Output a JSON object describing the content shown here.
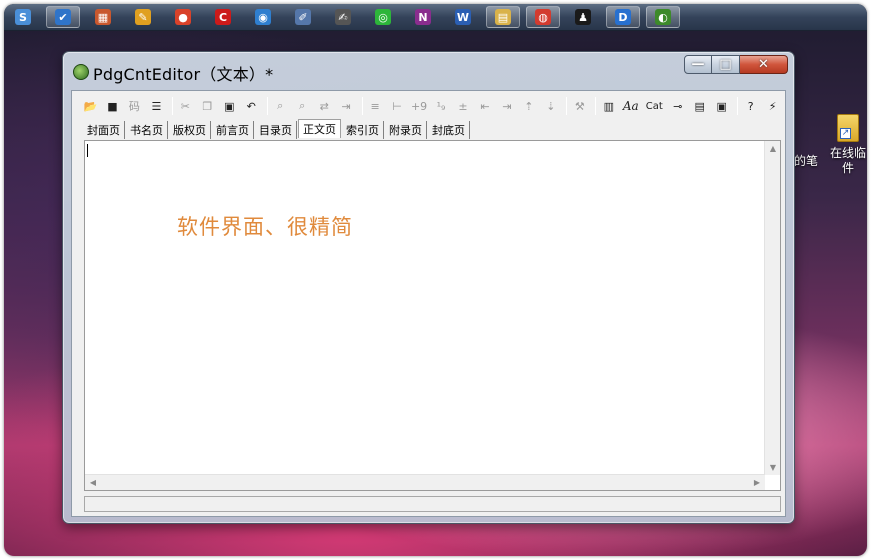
{
  "window": {
    "title": "PdgCntEditor（文本）*",
    "controls": {
      "minimize": "—",
      "maximize": "□",
      "close": "✕"
    }
  },
  "taskbar": {
    "apps": [
      {
        "icon": "shield-icon",
        "glyph": "S",
        "color": "#4a8fd8",
        "active": false
      },
      {
        "icon": "qq-browser-icon",
        "glyph": "✔",
        "color": "#2f74c9",
        "active": true
      },
      {
        "icon": "tools-icon",
        "glyph": "▦",
        "color": "#c9582e",
        "active": false
      },
      {
        "icon": "paint-icon",
        "glyph": "✎",
        "color": "#e0a020",
        "active": false
      },
      {
        "icon": "fox-icon",
        "glyph": "●",
        "color": "#d9422a",
        "active": false
      },
      {
        "icon": "flash-icon",
        "glyph": "C",
        "color": "#cc1a1a",
        "active": false
      },
      {
        "icon": "globe-icon",
        "glyph": "◉",
        "color": "#2f7fcf",
        "active": false
      },
      {
        "icon": "notes-icon",
        "glyph": "✐",
        "color": "#5577aa",
        "active": false
      },
      {
        "icon": "edit-icon",
        "glyph": "✍",
        "color": "#555555",
        "active": false
      },
      {
        "icon": "wechat-icon",
        "glyph": "◎",
        "color": "#2db53a",
        "active": false
      },
      {
        "icon": "onenote-icon",
        "glyph": "N",
        "color": "#8a2d8e",
        "active": false
      },
      {
        "icon": "word-icon",
        "glyph": "W",
        "color": "#2b5fb3",
        "active": false
      },
      {
        "icon": "folder-icon",
        "glyph": "▤",
        "color": "#d9b24a",
        "active": true
      },
      {
        "icon": "chrome-icon",
        "glyph": "◍",
        "color": "#d33b2f",
        "active": true
      },
      {
        "icon": "qq-icon",
        "glyph": "♟",
        "color": "#1a1a1a",
        "active": false
      },
      {
        "icon": "player-icon",
        "glyph": "D",
        "color": "#2770d0",
        "active": true
      },
      {
        "icon": "pdgcnteditor-icon",
        "glyph": "◐",
        "color": "#3d8a2a",
        "active": true
      }
    ]
  },
  "toolbar": {
    "cat_label": "Cat",
    "aa_label": "Aa"
  },
  "tabs": [
    {
      "label": "封面页",
      "active": false
    },
    {
      "label": "书名页",
      "active": false
    },
    {
      "label": "版权页",
      "active": false
    },
    {
      "label": "前言页",
      "active": false
    },
    {
      "label": "目录页",
      "active": false
    },
    {
      "label": "正文页",
      "active": true
    },
    {
      "label": "索引页",
      "active": false
    },
    {
      "label": "附录页",
      "active": false
    },
    {
      "label": "封底页",
      "active": false
    }
  ],
  "editor": {
    "annotation": "软件界面、很精简"
  },
  "desktop": {
    "icon_label_line1": "在线临",
    "icon_label_line2": "件",
    "partial_label": "的笔"
  }
}
